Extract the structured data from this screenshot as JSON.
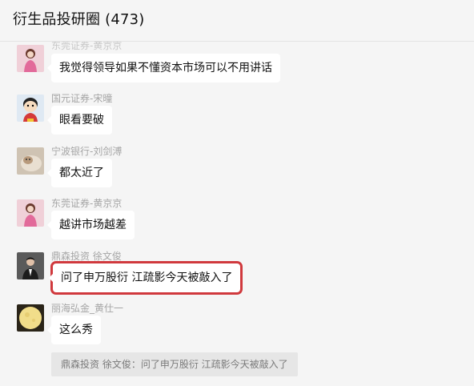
{
  "window": {
    "title": "衍生品投研圈 (473)"
  },
  "messages": [
    {
      "sender": "东莞证券-黄京京",
      "text": "我觉得领导如果不懂资本市场可以不用讲话",
      "avatar": "woman-in-pink-avatar"
    },
    {
      "sender": "国元证券-宋曈",
      "text": "眼看要破",
      "avatar": "cartoon-boy-avatar"
    },
    {
      "sender": "宁波银行-刘剑溥",
      "text": "都太近了",
      "avatar": "cat-avatar"
    },
    {
      "sender": "东莞证券-黄京京",
      "text": "越讲市场越差",
      "avatar": "woman-in-pink-avatar"
    },
    {
      "sender": "鼎森投资 徐文俊",
      "text": "问了申万股衍 江疏影今天被敲入了",
      "avatar": "man-in-suit-avatar"
    },
    {
      "sender": "丽海弘金_黄仕一",
      "text": "这么秀",
      "avatar": "moon-avatar"
    }
  ],
  "quote": {
    "text": "鼎森投资 徐文俊：问了申万股衍 江疏影今天被敲入了"
  },
  "colors": {
    "highlight": "#d0393d",
    "bubble": "#ffffff",
    "background": "#f5f5f5"
  }
}
